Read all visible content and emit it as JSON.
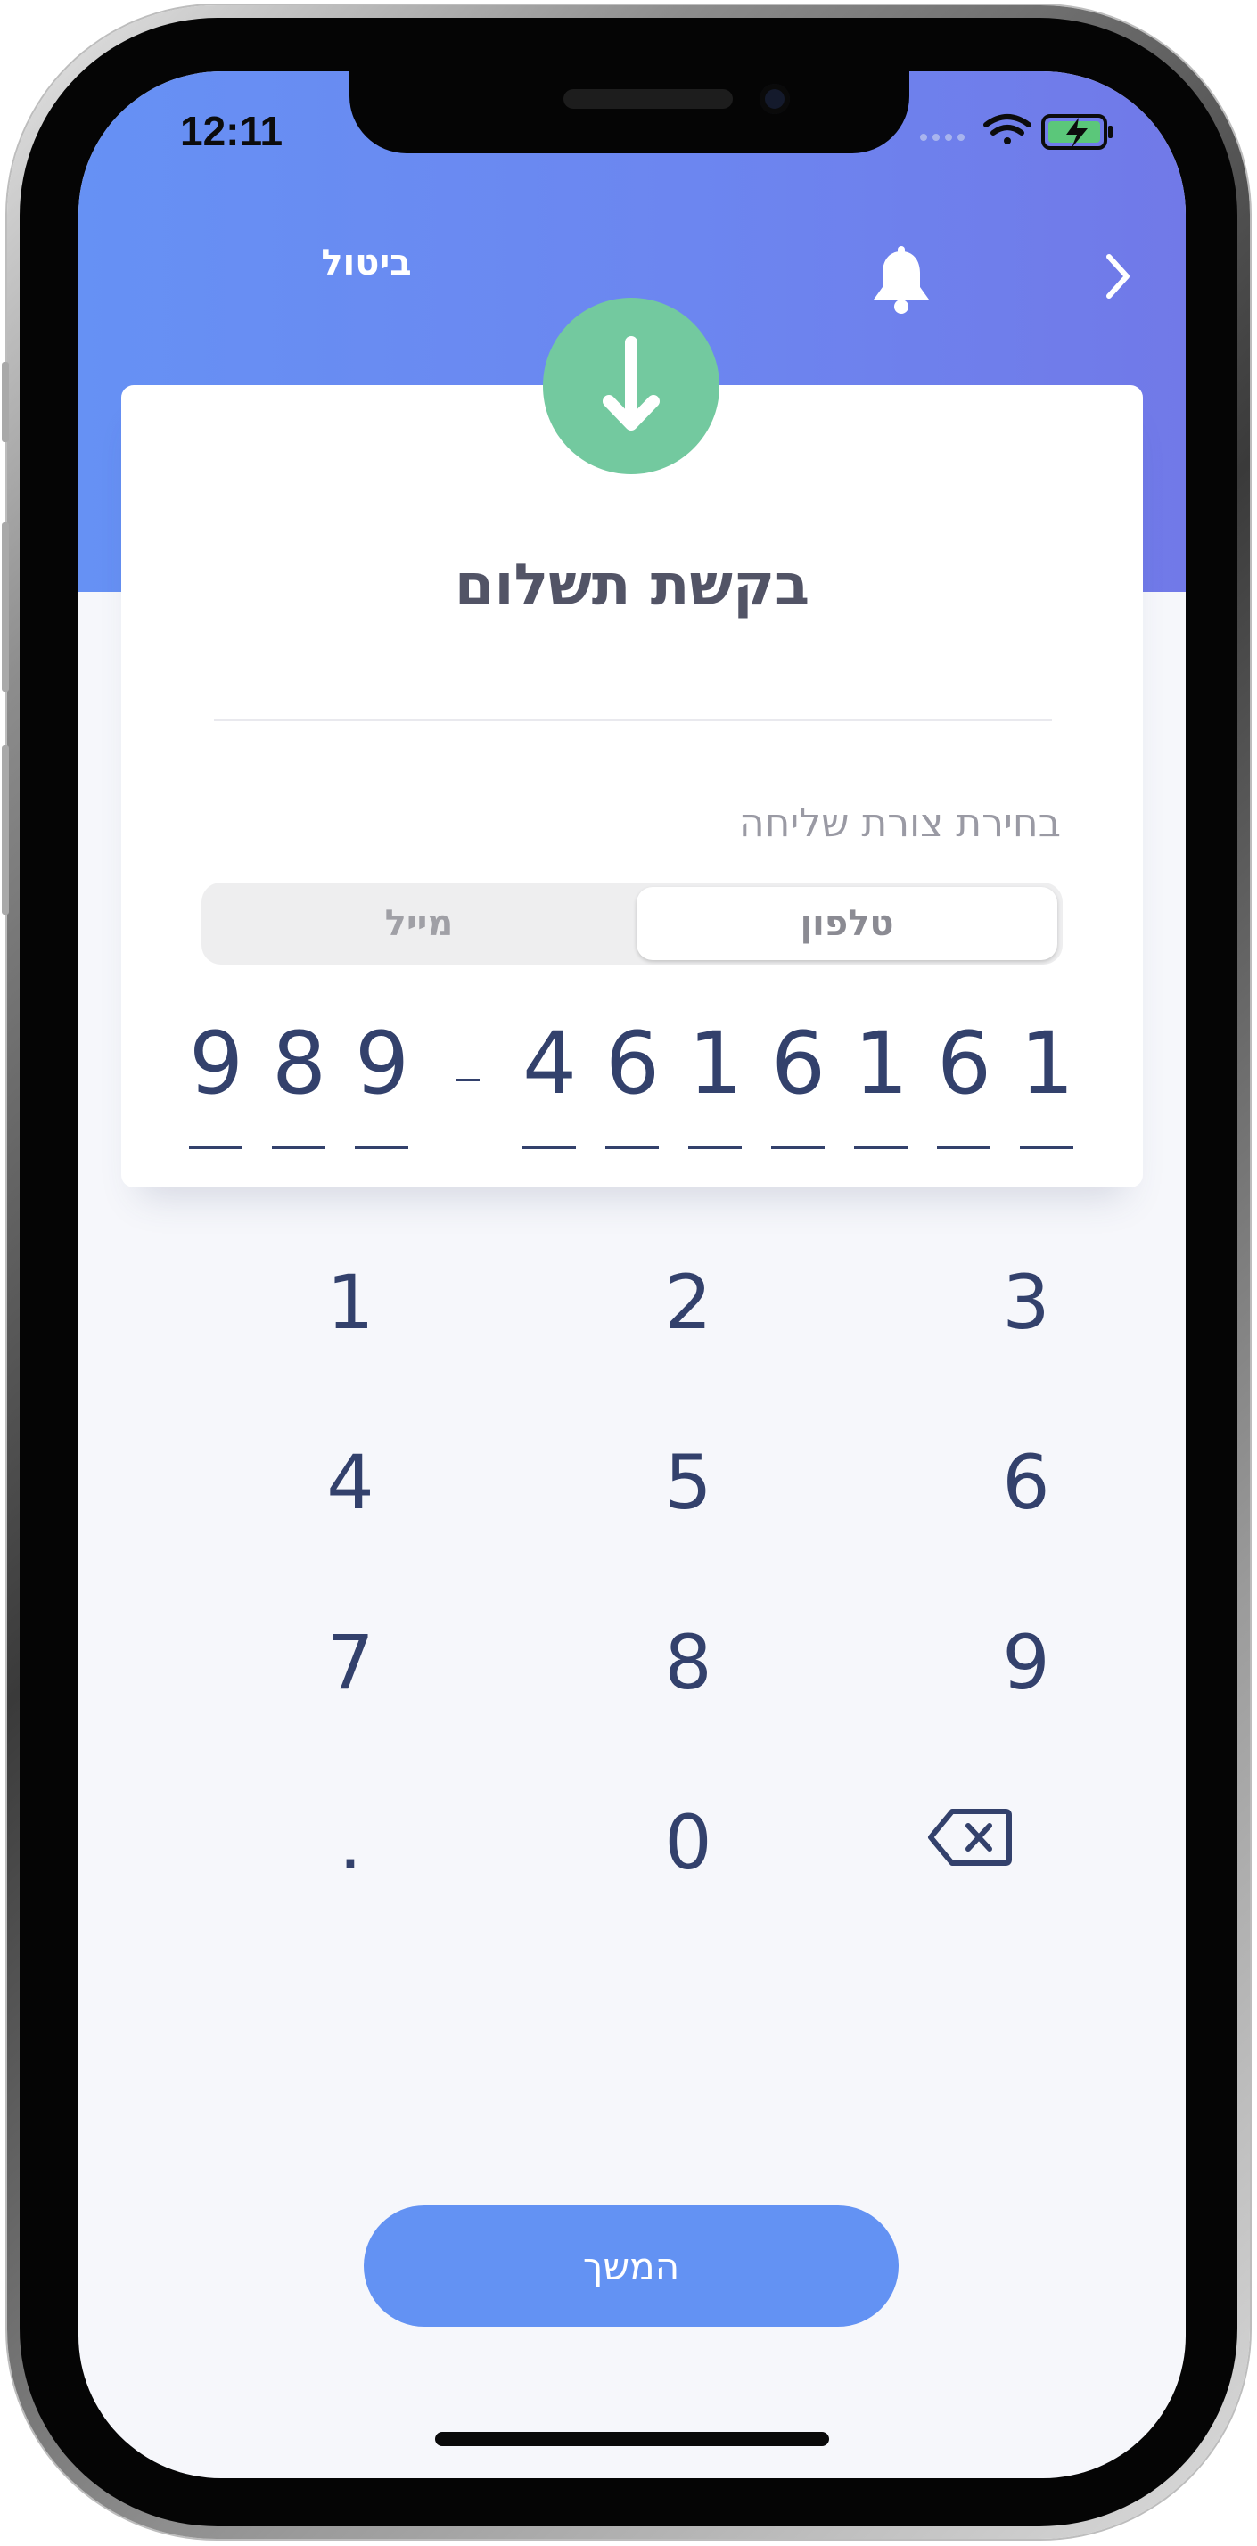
{
  "status_bar": {
    "time": "12:11"
  },
  "header": {
    "cancel_label": "ביטול"
  },
  "card": {
    "title": "בקשת תשלום",
    "send_method_label": "בחירת צורת שליחה",
    "segments": {
      "phone": "טלפון",
      "email": "מייל",
      "selected": "phone"
    }
  },
  "phone_number": {
    "prefix": [
      "9",
      "8",
      "9"
    ],
    "number": [
      "4",
      "6",
      "1",
      "6",
      "1",
      "6",
      "1"
    ]
  },
  "keypad": {
    "keys": [
      "1",
      "2",
      "3",
      "4",
      "5",
      "6",
      "7",
      "8",
      "9",
      ".",
      "0"
    ]
  },
  "continue_label": "המשך",
  "colors": {
    "header_gradient_start": "#6691f4",
    "header_gradient_end": "#7179e8",
    "accent_green": "#73c99f",
    "digit_color": "#33416c",
    "button_blue": "#6392f3"
  },
  "icons": [
    "bell-icon",
    "chevron-right-icon",
    "download-arrow-icon",
    "backspace-icon",
    "wifi-icon",
    "battery-charging-icon",
    "signal-dots-icon"
  ]
}
